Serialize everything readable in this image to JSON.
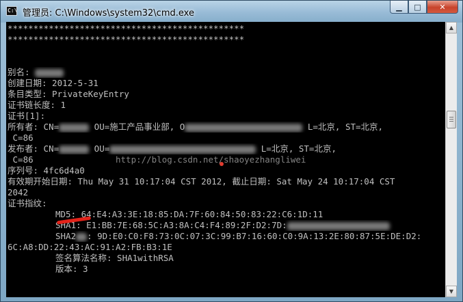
{
  "window": {
    "title": "管理员: C:\\Windows\\system32\\cmd.exe",
    "icon_label": "C:\\"
  },
  "controls": {
    "minimize_glyph": "▁",
    "maximize_glyph": "□",
    "close_glyph": "✕"
  },
  "scrollbar": {
    "up_glyph": "▲",
    "down_glyph": "▼"
  },
  "watermark": "http://blog.csdn.net/shaoyezhangliwei",
  "console": {
    "stars1": "**********************************************",
    "stars2": "**********************************************",
    "alias": "别名: ",
    "created": "创建日期: 2012-5-31",
    "entry_type": "条目类型: PrivateKeyEntry",
    "chain_len": "证书链长度: 1",
    "cert_index": "证书[1]:",
    "owner_a": "所有者: CN=",
    "owner_b": " OU=施工产品事业部, O",
    "owner_c": " L=北京, ST=北京,",
    "owner_d": " C=86",
    "issuer_a": "发布者: CN=",
    "issuer_b": " OU=",
    "issuer_c": " L=北京, ST=北京,",
    "issuer_d": " C=86",
    "serial": "序列号: 4fc6d4a0",
    "validity1": "有效期开始日期: Thu May 31 10:17:04 CST 2012, 截止日期: Sat May 24 10:17:04 CST",
    "validity2": "2042",
    "fingerprint": "证书指纹:",
    "md5": "MD5: 64:E4:A3:3E:18:85:DA:7F:60:84:50:83:22:C6:1D:11",
    "sha1": "SHA1: E1:BB:7E:68:5C:A3:8A:C4:F4:89:2F:D2:7D:",
    "sha256a": "SHA2",
    "sha256b": ": 9D:E0:C0:F8:73:0C:07:3C:99:B7:16:60:C0:9A:13:2E:80:87:5E:DE:D2:",
    "sha256c": "6C:A8:DD:22:43:AC:91:A2:FB:B3:1E",
    "sig_alg": "签名算法名称: SHA1withRSA",
    "version": "版本: 3"
  }
}
